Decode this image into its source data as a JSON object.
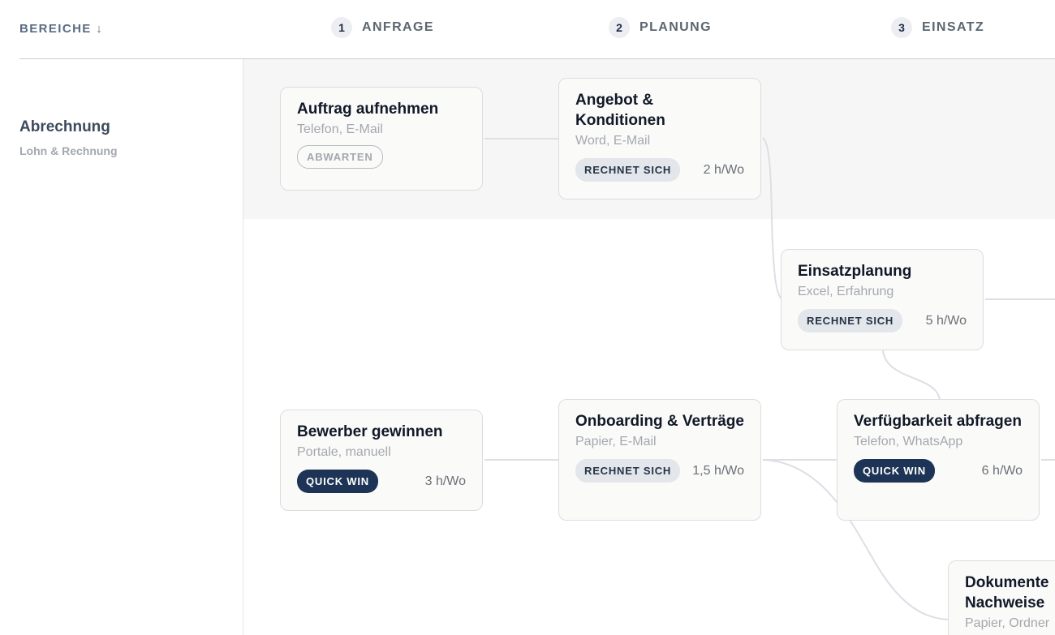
{
  "header": {
    "bereiche_label": "BEREICHE ↓",
    "phases": [
      {
        "number": "1",
        "label": "ANFRAGE"
      },
      {
        "number": "2",
        "label": "PLANUNG"
      },
      {
        "number": "3",
        "label": "EINSATZ"
      }
    ]
  },
  "lanes": [
    {
      "title": "Abrechnung",
      "subtitle": "Lohn & Rechnung"
    }
  ],
  "cards": [
    {
      "id": "auftrag",
      "title": "Auftrag aufnehmen",
      "tools": "Telefon, E-Mail",
      "tag": "ABWARTEN",
      "tag_type": "wait",
      "hours": ""
    },
    {
      "id": "angebot",
      "title": "Angebot & Konditionen",
      "tools": "Word, E-Mail",
      "tag": "RECHNET SICH",
      "tag_type": "calc",
      "hours": "2 h/Wo"
    },
    {
      "id": "einsatzplanung",
      "title": "Einsatzplanung",
      "tools": "Excel, Erfahrung",
      "tag": "RECHNET SICH",
      "tag_type": "calc",
      "hours": "5 h/Wo"
    },
    {
      "id": "bewerber",
      "title": "Bewerber gewinnen",
      "tools": "Portale, manuell",
      "tag": "QUICK WIN",
      "tag_type": "quick",
      "hours": "3 h/Wo"
    },
    {
      "id": "onboarding",
      "title": "Onboarding & Verträge",
      "tools": "Papier, E-Mail",
      "tag": "RECHNET SICH",
      "tag_type": "calc",
      "hours": "1,5 h/Wo"
    },
    {
      "id": "verfuegbarkeit",
      "title": "Verfügbarkeit abfragen",
      "tools": "Telefon, WhatsApp",
      "tag": "QUICK WIN",
      "tag_type": "quick",
      "hours": "6 h/Wo"
    },
    {
      "id": "dokumente",
      "title": "Dokumente Nachweise",
      "tools": "Papier, Ordner",
      "tag": "",
      "tag_type": "",
      "hours": ""
    }
  ],
  "colors": {
    "accent_navy": "#1d3456",
    "calc_badge_bg": "#e3e6ea",
    "lane_band_bg": "#f6f6f6",
    "connector": "#dcdfe4"
  }
}
